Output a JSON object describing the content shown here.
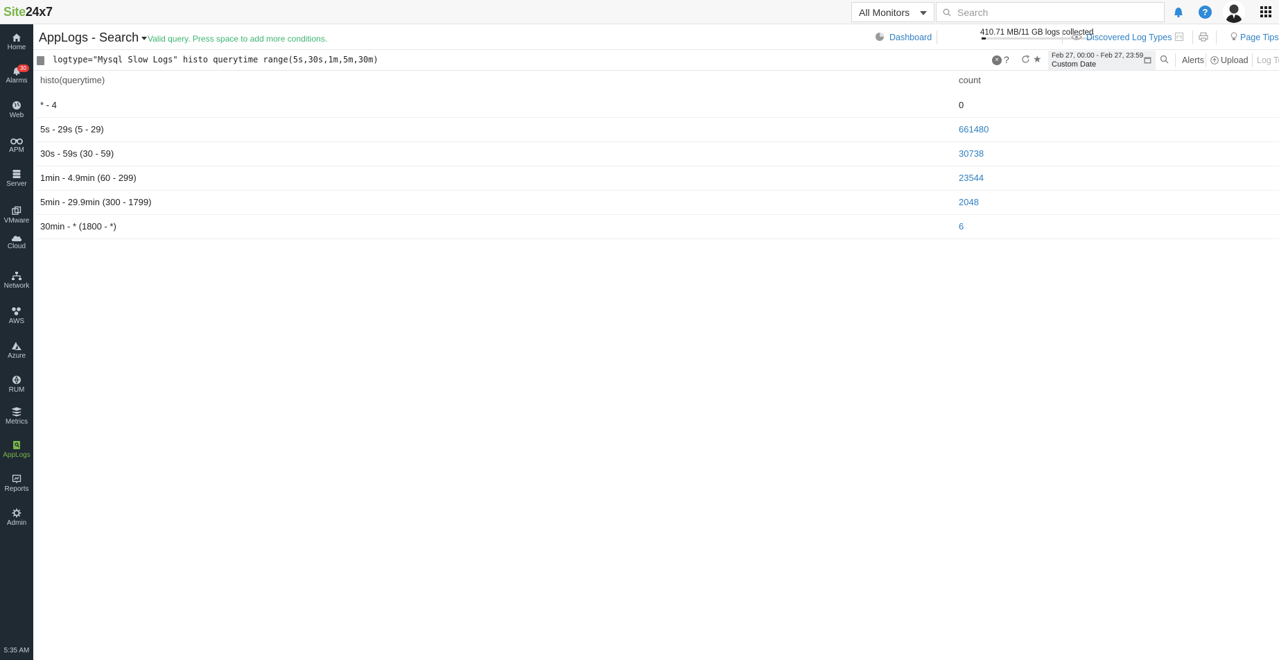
{
  "app": {
    "logo_part1": "Site",
    "logo_part2": "24x7"
  },
  "topbar": {
    "monitor_select": "All Monitors",
    "search_placeholder": "Search"
  },
  "sidebar": {
    "items": [
      {
        "label": "Home",
        "icon": "home-icon"
      },
      {
        "label": "Alarms",
        "icon": "bell-icon",
        "badge": "30"
      },
      {
        "label": "Web",
        "icon": "globe-icon"
      },
      {
        "label": "APM",
        "icon": "binoculars-icon"
      },
      {
        "label": "Server",
        "icon": "server-icon"
      },
      {
        "label": "VMware",
        "icon": "vmware-icon"
      },
      {
        "label": "Cloud",
        "icon": "cloud-icon"
      },
      {
        "label": "Network",
        "icon": "network-icon"
      },
      {
        "label": "AWS",
        "icon": "aws-icon"
      },
      {
        "label": "Azure",
        "icon": "azure-icon"
      },
      {
        "label": "RUM",
        "icon": "rum-icon"
      },
      {
        "label": "Metrics",
        "icon": "metrics-icon"
      },
      {
        "label": "AppLogs",
        "icon": "applogs-icon",
        "active": true
      },
      {
        "label": "Reports",
        "icon": "reports-icon"
      },
      {
        "label": "Admin",
        "icon": "gear-icon"
      }
    ],
    "clock": "5:35 AM"
  },
  "header": {
    "title": "AppLogs - Search",
    "validation": "Valid query. Press space to add more conditions.",
    "dashboard_link": "Dashboard",
    "collected": "410.71 MB/11 GB logs collected",
    "collected_fraction": 0.037,
    "discovered_link": "Discovered Log Types",
    "page_tips": "Page Tips"
  },
  "query": {
    "text": "logtype=\"Mysql Slow Logs\" histo querytime range(5s,30s,1m,5m,30m)",
    "help": "?",
    "date_range": "Feb 27, 00:00 - Feb 27, 23:59",
    "date_label": "Custom Date",
    "alerts": "Alerts",
    "upload": "Upload",
    "log_templates": "Log Templates"
  },
  "results": {
    "columns": [
      "histo(querytime)",
      "count"
    ],
    "rows": [
      {
        "range": "* - 4",
        "count": "0"
      },
      {
        "range": "5s - 29s (5 - 29)",
        "count": "661480"
      },
      {
        "range": "30s - 59s (30 - 59)",
        "count": "30738"
      },
      {
        "range": "1min - 4.9min (60 - 299)",
        "count": "23544"
      },
      {
        "range": "5min - 29.9min (300 - 1799)",
        "count": "2048"
      },
      {
        "range": "30min - * (1800 - *)",
        "count": "6"
      }
    ]
  },
  "colors": {
    "brand_green": "#7ab648",
    "link_blue": "#2f7fc1",
    "sidebar_bg": "#1f2a33",
    "valid_green": "#3cb371",
    "badge_red": "#e53935"
  }
}
